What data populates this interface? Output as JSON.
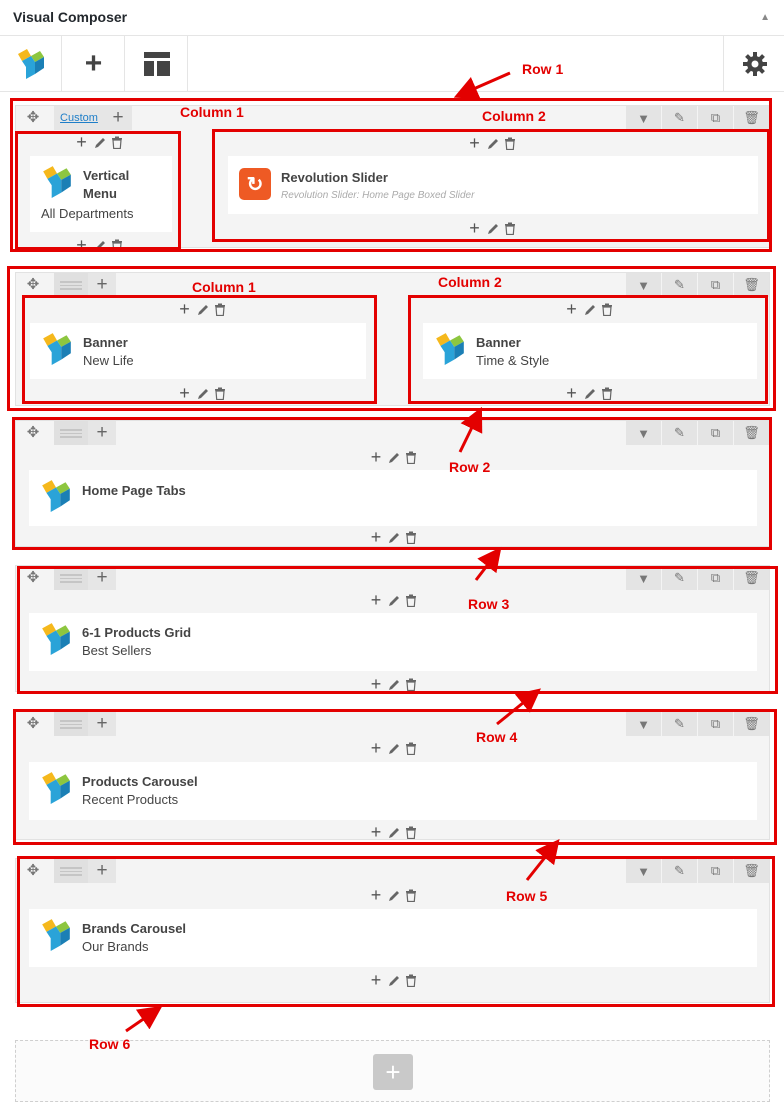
{
  "panel": {
    "title": "Visual Composer"
  },
  "toolbar": {
    "add_label": "+",
    "brand_icon": "vc-logo-icon",
    "templates_icon": "templates-icon",
    "settings_icon": "gear-icon"
  },
  "rows": [
    {
      "layout_label": "Custom",
      "columns": [
        {
          "element": {
            "title_line1": "Vertical",
            "title_line2": "Menu",
            "subtitle": "All Departments"
          }
        },
        {
          "element": {
            "title": "Revolution Slider",
            "note": "Revolution Slider: Home Page Boxed Slider"
          }
        }
      ]
    },
    {
      "columns": [
        {
          "element": {
            "title": "Banner",
            "subtitle": "New Life"
          }
        },
        {
          "element": {
            "title": "Banner",
            "subtitle": "Time & Style"
          }
        }
      ]
    },
    {
      "columns": [
        {
          "element": {
            "title": "Home Page Tabs"
          }
        }
      ]
    },
    {
      "columns": [
        {
          "element": {
            "title": "6-1 Products Grid",
            "subtitle": "Best Sellers"
          }
        }
      ]
    },
    {
      "columns": [
        {
          "element": {
            "title": "Products Carousel",
            "subtitle": "Recent Products"
          }
        }
      ]
    },
    {
      "columns": [
        {
          "element": {
            "title": "Brands Carousel",
            "subtitle": "Our Brands"
          }
        }
      ]
    }
  ],
  "annotations": {
    "row1": "Row 1",
    "row2": "Row 2",
    "row3": "Row 3",
    "row4": "Row 4",
    "row5": "Row 5",
    "row6": "Row 6",
    "r1_col1": "Column 1",
    "r1_col2": "Column 2",
    "r2_col1": "Column 1",
    "r2_col2": "Column 2",
    "color": "#e30000"
  },
  "add_row": {
    "label": "+"
  }
}
